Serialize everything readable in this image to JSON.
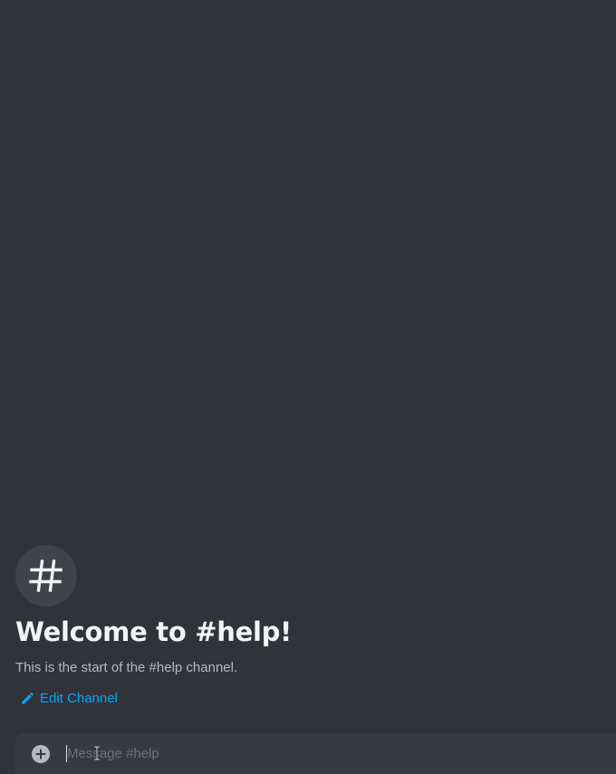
{
  "channel": {
    "icon": "hash-icon",
    "welcome_title": "Welcome to #help!",
    "welcome_subtitle": "This is the start of the #help channel.",
    "edit_label": "Edit Channel"
  },
  "composer": {
    "attach_icon": "plus-circle-icon",
    "value": "",
    "placeholder": "Message #help"
  },
  "colors": {
    "background": "#313338",
    "composer_bg": "#383a40",
    "link": "#00a8fc",
    "title": "#f2f3f5",
    "muted": "#b5bac1"
  }
}
